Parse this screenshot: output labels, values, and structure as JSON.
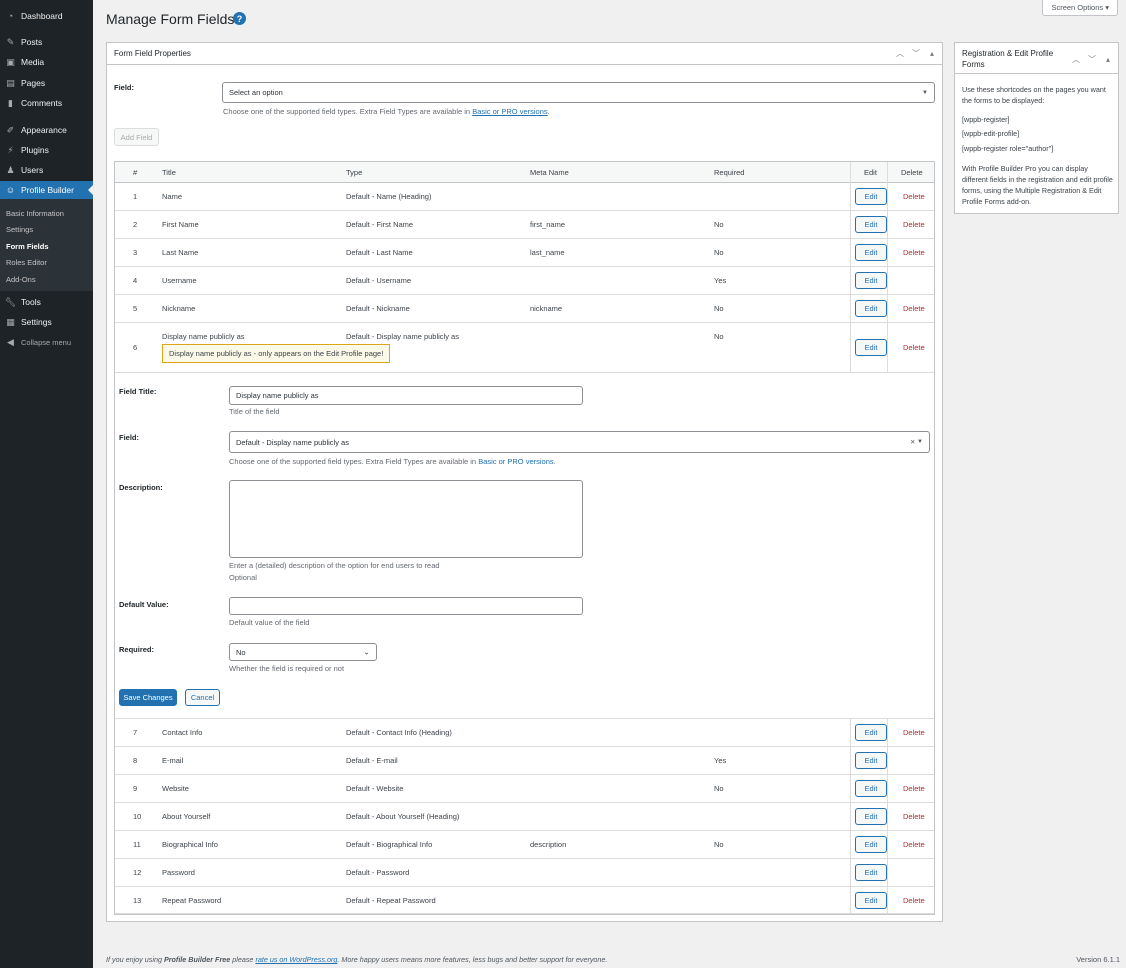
{
  "sidebar": {
    "items": [
      {
        "label": "Dashboard",
        "icon": "dashboard-icon"
      },
      {
        "label": "Posts",
        "icon": "pin-icon"
      },
      {
        "label": "Media",
        "icon": "media-icon"
      },
      {
        "label": "Pages",
        "icon": "page-icon"
      },
      {
        "label": "Comments",
        "icon": "comment-icon"
      },
      {
        "label": "Appearance",
        "icon": "brush-icon"
      },
      {
        "label": "Plugins",
        "icon": "plug-icon"
      },
      {
        "label": "Users",
        "icon": "users-icon"
      },
      {
        "label": "Profile Builder",
        "icon": "user-icon"
      },
      {
        "label": "Tools",
        "icon": "wrench-icon"
      },
      {
        "label": "Settings",
        "icon": "settings-icon"
      }
    ],
    "submenu": [
      "Basic Information",
      "Settings",
      "Form Fields",
      "Roles Editor",
      "Add-Ons"
    ],
    "collapse_label": "Collapse menu"
  },
  "header": {
    "title": "Manage Form Fields",
    "help_glyph": "?",
    "screen_options": "Screen Options ▾"
  },
  "main_box": {
    "title": "Form Field Properties",
    "field_label": "Field:",
    "field_placeholder": "Select an option",
    "field_desc_prefix": "Choose one of the supported field types. Extra Field Types are available in ",
    "field_desc_link": "Basic or PRO versions",
    "field_desc_suffix": ".",
    "add_field_button": "Add Field"
  },
  "table": {
    "headers": [
      "#",
      "Title",
      "Type",
      "Meta Name",
      "Required",
      "Edit",
      "Delete"
    ],
    "edit_label": "Edit",
    "delete_label": "Delete",
    "rows_top": [
      {
        "num": "1",
        "title": "Name",
        "type": "Default - Name (Heading)",
        "meta": "",
        "required": "",
        "deletable": true
      },
      {
        "num": "2",
        "title": "First Name",
        "type": "Default - First Name",
        "meta": "first_name",
        "required": "No",
        "deletable": true
      },
      {
        "num": "3",
        "title": "Last Name",
        "type": "Default - Last Name",
        "meta": "last_name",
        "required": "No",
        "deletable": true
      },
      {
        "num": "4",
        "title": "Username",
        "type": "Default - Username",
        "meta": "",
        "required": "Yes",
        "deletable": false
      },
      {
        "num": "5",
        "title": "Nickname",
        "type": "Default - Nickname",
        "meta": "nickname",
        "required": "No",
        "deletable": true
      },
      {
        "num": "6",
        "title": "Display name publicly as",
        "type": "Default - Display name publicly as",
        "meta": "",
        "required": "No",
        "deletable": true,
        "hint": "Display name publicly as - only appears on the Edit Profile page!"
      }
    ],
    "rows_bottom": [
      {
        "num": "7",
        "title": "Contact Info",
        "type": "Default - Contact Info (Heading)",
        "meta": "",
        "required": "",
        "deletable": true
      },
      {
        "num": "8",
        "title": "E-mail",
        "type": "Default - E-mail",
        "meta": "",
        "required": "Yes",
        "deletable": false
      },
      {
        "num": "9",
        "title": "Website",
        "type": "Default - Website",
        "meta": "",
        "required": "No",
        "deletable": true
      },
      {
        "num": "10",
        "title": "About Yourself",
        "type": "Default - About Yourself (Heading)",
        "meta": "",
        "required": "",
        "deletable": true
      },
      {
        "num": "11",
        "title": "Biographical Info",
        "type": "Default - Biographical Info",
        "meta": "description",
        "required": "No",
        "deletable": true
      },
      {
        "num": "12",
        "title": "Password",
        "type": "Default - Password",
        "meta": "",
        "required": "",
        "deletable": false
      },
      {
        "num": "13",
        "title": "Repeat Password",
        "type": "Default - Repeat Password",
        "meta": "",
        "required": "",
        "deletable": true
      }
    ]
  },
  "edit_panel": {
    "field_title_label": "Field Title:",
    "field_title_value": "Display name publicly as",
    "field_title_desc": "Title of the field",
    "field_label": "Field:",
    "field_value": "Default - Display name publicly as",
    "field_clear": "×",
    "field_desc_prefix": "Choose one of the supported field types. Extra Field Types are available in ",
    "field_desc_link": "Basic or PRO versions",
    "field_desc_suffix": ".",
    "description_label": "Description:",
    "description_value": "",
    "description_desc1": "Enter a (detailed) description of the option for end users to read",
    "description_desc2": "Optional",
    "default_label": "Default Value:",
    "default_value": "",
    "default_desc": "Default value of the field",
    "required_label": "Required:",
    "required_value": "No",
    "required_desc": "Whether the field is required or not",
    "save_button": "Save Changes",
    "cancel_button": "Cancel"
  },
  "side_box": {
    "title": "Registration & Edit Profile Forms",
    "intro": "Use these shortcodes on the pages you want the forms to be displayed:",
    "shortcodes": [
      "[wppb-register]",
      "[wppb-edit-profile]",
      "[wppb-register role=\"author\"]"
    ],
    "outro": "With Profile Builder Pro you can display different fields in the registration and edit profile forms, using the Multiple Registration & Edit Profile Forms add-on."
  },
  "footer": {
    "prefix": "If you enjoy using ",
    "product": "Profile Builder Free",
    "middle": " please ",
    "link": "rate us on WordPress.org",
    "suffix": ". More happy users means more features, less bugs and better support for everyone.",
    "version": "Version 6.1.1"
  },
  "colors": {
    "accent": "#2271b1",
    "sidebar_bg": "#1d2327",
    "delete": "#b32d2e",
    "hint_border": "#dba617"
  }
}
